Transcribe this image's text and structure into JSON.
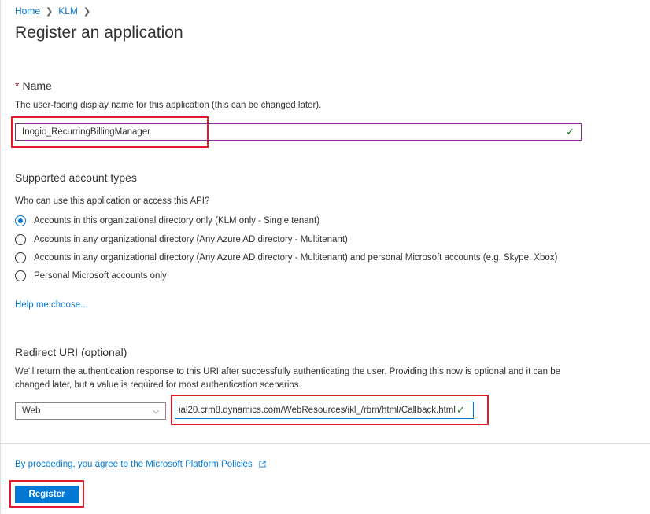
{
  "breadcrumb": {
    "items": [
      "Home",
      "KLM"
    ]
  },
  "page_title": "Register an application",
  "name_section": {
    "required_marker": "*",
    "label": "Name",
    "description": "The user-facing display name for this application (this can be changed later).",
    "value": "Inogic_RecurringBillingManager"
  },
  "account_types": {
    "label": "Supported account types",
    "question": "Who can use this application or access this API?",
    "options": [
      {
        "label": "Accounts in this organizational directory only (KLM only - Single tenant)",
        "selected": true
      },
      {
        "label": "Accounts in any organizational directory (Any Azure AD directory - Multitenant)",
        "selected": false
      },
      {
        "label": "Accounts in any organizational directory (Any Azure AD directory - Multitenant) and personal Microsoft accounts (e.g. Skype, Xbox)",
        "selected": false
      },
      {
        "label": "Personal Microsoft accounts only",
        "selected": false
      }
    ],
    "help_link": "Help me choose..."
  },
  "redirect": {
    "label": "Redirect URI (optional)",
    "description_line1": "We'll return the authentication response to this URI after successfully authenticating the user. Providing this now is optional and it can be",
    "description_line2": "changed later, but a value is required for most authentication scenarios.",
    "platform_selected": "Web",
    "uri_value": "ial20.crm8.dynamics.com/WebResources/ikl_/rbm/html/Callback.html"
  },
  "footer": {
    "policy_text": "By proceeding, you agree to the Microsoft Platform Policies",
    "register_label": "Register"
  },
  "colors": {
    "accent": "#0078d4",
    "highlight_box": "#e0192b",
    "valid_check": "#107c10"
  }
}
